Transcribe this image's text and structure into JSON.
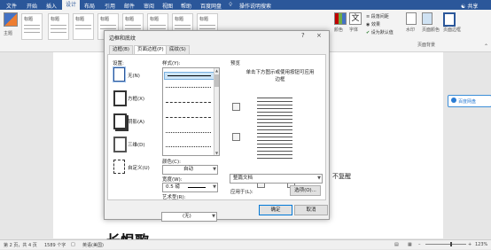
{
  "ribbon": {
    "tabs": [
      "文件",
      "开始",
      "插入",
      "设计",
      "布局",
      "引用",
      "邮件",
      "审阅",
      "视图",
      "帮助",
      "百度网盘",
      "操作说明搜索"
    ],
    "active_tab": "设计",
    "share_label": "共享",
    "theme_label": "主题",
    "colors_label": "颜色",
    "fonts_label": "字体",
    "paragraph_spacing_label": "段落间距",
    "effects_label": "效果",
    "set_default_label": "设为默认值",
    "watermark_label": "水印",
    "page_color_label": "页面颜色",
    "page_border_label": "页面边框",
    "page_background_group": "页面背景",
    "style_thumbs": [
      "标题",
      "标题",
      "标题",
      "标题",
      "标题",
      "标题",
      "标题",
      "标题"
    ]
  },
  "document": {
    "side_button": "百度网盘",
    "text_fragment": "不复醒",
    "big_text": "长恨歌"
  },
  "statusbar": {
    "page": "第 2 页，共 4 页",
    "words": "1589 个字",
    "lang": "英语(美国)",
    "zoom": "123%"
  },
  "dialog": {
    "title": "边框和底纹",
    "help": "?",
    "close": "×",
    "tabs": [
      "边框(B)",
      "页面边框(P)",
      "底纹(S)"
    ],
    "active_tab": "页面边框(P)",
    "setting_label": "设置:",
    "settings": [
      "无(N)",
      "方框(X)",
      "阴影(A)",
      "三维(D)",
      "自定义(U)"
    ],
    "style_label": "样式(Y):",
    "color_label": "颜色(C):",
    "color_value": "自动",
    "width_label": "宽度(W):",
    "width_value": "0.5 磅",
    "art_label": "艺术型(R):",
    "art_value": "(无)",
    "preview_label": "预览",
    "preview_hint": "单击下方图示或使用按钮可应用边框",
    "apply_label": "应用于(L):",
    "apply_value": "整篇文档",
    "options_button": "选项(O)...",
    "ok_button": "确定",
    "cancel_button": "取消"
  }
}
